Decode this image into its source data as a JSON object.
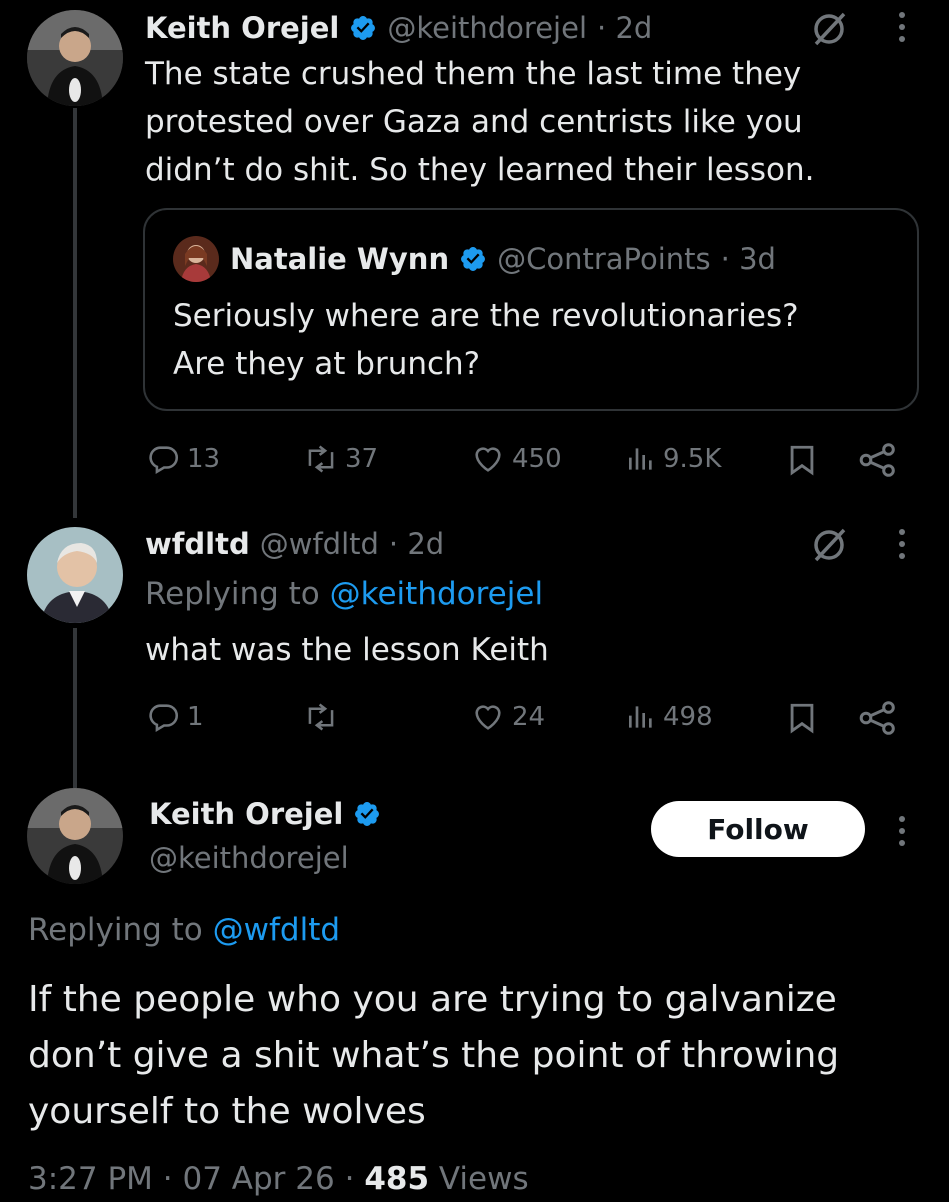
{
  "colors": {
    "background": "#000000",
    "text_primary": "#e7e9ea",
    "text_muted": "#71767b",
    "accent_link": "#1d9bf0",
    "verified_badge": "#1d9bf0",
    "thread_line": "#333639"
  },
  "tweet1": {
    "display_name": "Keith Orejel",
    "handle": "@keithdorejel",
    "time": "· 2d",
    "text_line1": "The state crushed them the last time they",
    "text_line2": "protested over Gaza and centrists like you",
    "text_line3": "didn’t do shit. So they learned their lesson.",
    "quote": {
      "display_name": "Natalie Wynn",
      "handle": "@ContraPoints",
      "time": "· 3d",
      "text_line1": "Seriously where are the revolutionaries?",
      "text_line2": "Are they at brunch?"
    },
    "stats": {
      "replies": "13",
      "reposts": "37",
      "likes": "450",
      "views": "9.5K"
    }
  },
  "tweet2": {
    "display_name": "wfdltd",
    "handle": "@wfdltd",
    "time": "· 2d",
    "replying_prefix": "Replying to",
    "replying_handle": "@keithdorejel",
    "text": "what was the lesson Keith",
    "stats": {
      "replies": "1",
      "reposts": "",
      "likes": "24",
      "views": "498"
    }
  },
  "tweet3": {
    "display_name": "Keith Orejel",
    "handle": "@keithdorejel",
    "follow_label": "Follow",
    "replying_prefix": "Replying to",
    "replying_handle": "@wfdltd",
    "text_line1": "If the people who you are trying to galvanize",
    "text_line2": "don’t give a shit what’s the point of throwing",
    "text_line3": "yourself to the wolves",
    "meta_time": "3:27 PM",
    "meta_sep1": "·",
    "meta_date": "07 Apr 26",
    "meta_sep2": "·",
    "meta_views_count": "485",
    "meta_views_label": "Views"
  },
  "icons": [
    "reply-icon",
    "repost-icon",
    "like-icon",
    "views-icon",
    "bookmark-icon",
    "share-icon",
    "grok-icon",
    "more-icon",
    "verified-icon"
  ]
}
